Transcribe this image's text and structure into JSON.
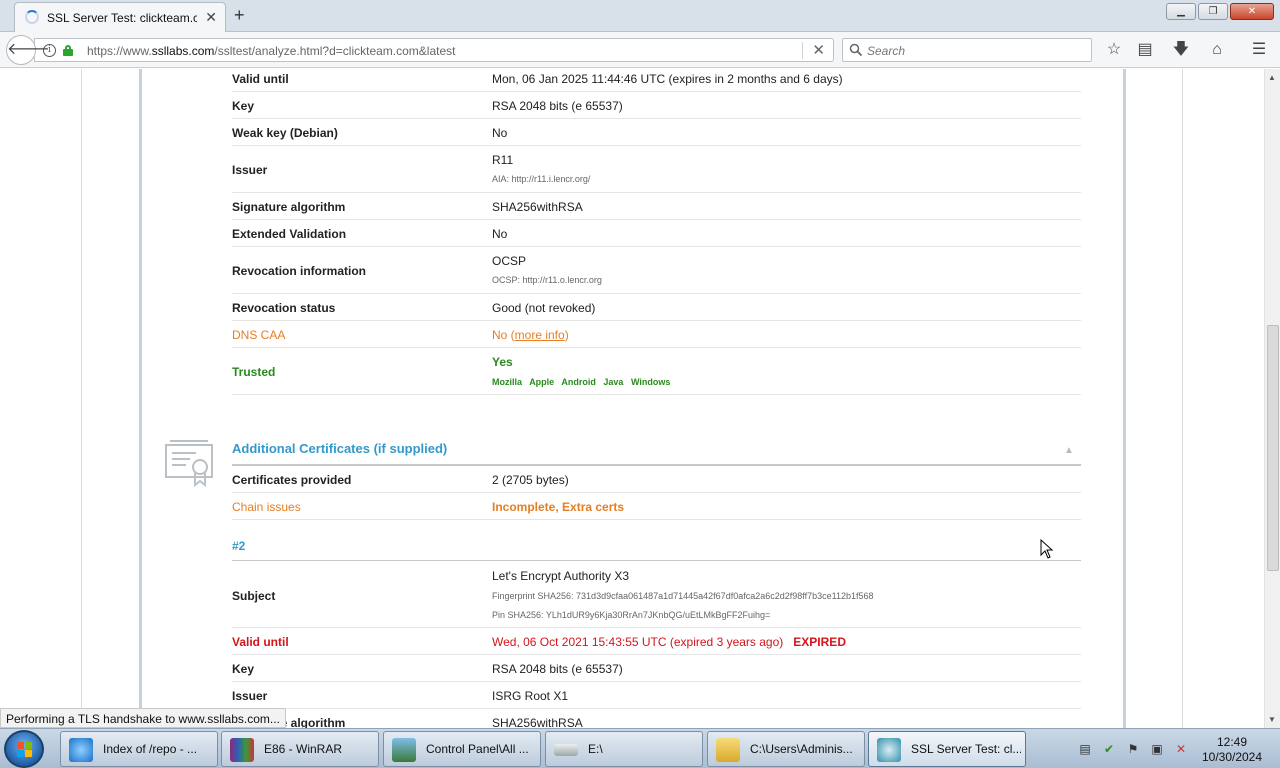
{
  "browser": {
    "tab_title": "SSL Server Test: clickteam.co",
    "url_prefix": "https://www.",
    "url_domain": "ssllabs.com",
    "url_path": "/ssltest/analyze.html?d=clickteam.com&latest",
    "search_placeholder": "Search"
  },
  "cert1": {
    "valid_until_label": "Valid until",
    "valid_until_value": "Mon, 06 Jan 2025 11:44:46 UTC (expires in 2 months and 6 days)",
    "key_label": "Key",
    "key_value": "RSA 2048 bits (e 65537)",
    "weak_key_label": "Weak key (Debian)",
    "weak_key_value": "No",
    "issuer_label": "Issuer",
    "issuer_value": "R11",
    "issuer_aia": "AIA: http://r11.i.lencr.org/",
    "sig_label": "Signature algorithm",
    "sig_value": "SHA256withRSA",
    "ev_label": "Extended Validation",
    "ev_value": "No",
    "revinfo_label": "Revocation information",
    "revinfo_value": "OCSP",
    "revinfo_sub": "OCSP: http://r11.o.lencr.org",
    "revstatus_label": "Revocation status",
    "revstatus_value": "Good (not revoked)",
    "caa_label": "DNS CAA",
    "caa_value_prefix": "No (",
    "caa_link": "more info",
    "caa_value_suffix": ")",
    "trusted_label": "Trusted",
    "trusted_value": "Yes",
    "trust_stores": [
      "Mozilla",
      "Apple",
      "Android",
      "Java",
      "Windows"
    ]
  },
  "additional": {
    "title": "Additional Certificates (if supplied)",
    "provided_label": "Certificates provided",
    "provided_value": "2 (2705 bytes)",
    "chain_label": "Chain issues",
    "chain_value": "Incomplete, Extra certs",
    "subtitle": "#2",
    "subject_label": "Subject",
    "subject_value": "Let's Encrypt Authority X3",
    "subject_fp": "Fingerprint SHA256: 731d3d9cfaa061487a1d71445a42f67df0afca2a6c2d2f98ff7b3ce112b1f568",
    "subject_pin": "Pin SHA256: YLh1dUR9y6Kja30RrAn7JKnbQG/uEtLMkBgFF2Fuihg=",
    "valid_until_label": "Valid until",
    "valid_until_value": "Wed, 06 Oct 2021 15:43:55 UTC (expired 3 years ago)",
    "expired_badge": "EXPIRED",
    "key_label": "Key",
    "key_value": "RSA 2048 bits (e 65537)",
    "issuer_label": "Issuer",
    "issuer_value": "ISRG Root X1",
    "sig_label": "Signature algorithm",
    "sig_value": "SHA256withRSA"
  },
  "status_text": "Performing a TLS handshake to www.ssllabs.com...",
  "taskbar": {
    "items": [
      {
        "label": "Index of /repo - ...",
        "icon": "internet-explorer-icon"
      },
      {
        "label": "E86 - WinRAR",
        "icon": "winrar-icon"
      },
      {
        "label": "Control Panel\\All ...",
        "icon": "control-panel-icon"
      },
      {
        "label": "E:\\",
        "icon": "drive-icon"
      },
      {
        "label": "C:\\Users\\Adminis...",
        "icon": "folder-icon"
      },
      {
        "label": "SSL Server Test: cl...",
        "icon": "browser-icon"
      }
    ],
    "time": "12:49",
    "date": "10/30/2024"
  },
  "colors": {
    "section_blue": "#3399cc",
    "warn_orange": "#e67e22",
    "ok_green": "#2a8a1e",
    "error_red": "#d5151c"
  }
}
